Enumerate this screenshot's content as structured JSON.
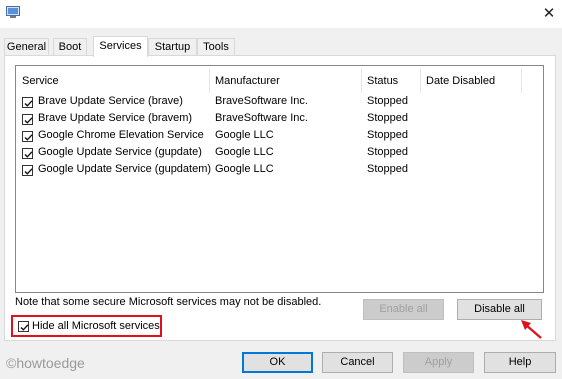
{
  "window": {
    "close_glyph": "✕"
  },
  "tabs": [
    {
      "label": "General"
    },
    {
      "label": "Boot"
    },
    {
      "label": "Services"
    },
    {
      "label": "Startup"
    },
    {
      "label": "Tools"
    }
  ],
  "services": {
    "columns": [
      "Service",
      "Manufacturer",
      "Status",
      "Date Disabled"
    ],
    "rows": [
      {
        "checked": true,
        "service": "Brave Update Service (brave)",
        "manufacturer": "BraveSoftware Inc.",
        "status": "Stopped",
        "date_disabled": ""
      },
      {
        "checked": true,
        "service": "Brave Update Service (bravem)",
        "manufacturer": "BraveSoftware Inc.",
        "status": "Stopped",
        "date_disabled": ""
      },
      {
        "checked": true,
        "service": "Google Chrome Elevation Service",
        "manufacturer": "Google LLC",
        "status": "Stopped",
        "date_disabled": ""
      },
      {
        "checked": true,
        "service": "Google Update Service (gupdate)",
        "manufacturer": "Google LLC",
        "status": "Stopped",
        "date_disabled": ""
      },
      {
        "checked": true,
        "service": "Google Update Service (gupdatem)",
        "manufacturer": "Google LLC",
        "status": "Stopped",
        "date_disabled": ""
      }
    ],
    "note": "Note that some secure Microsoft services may not be disabled.",
    "enable_all_label": "Enable all",
    "disable_all_label": "Disable all",
    "hide_ms_label": "Hide all Microsoft services",
    "hide_ms_checked": true
  },
  "footer": {
    "ok_label": "OK",
    "cancel_label": "Cancel",
    "apply_label": "Apply",
    "help_label": "Help"
  },
  "watermark": "©howtoedge",
  "colors": {
    "highlight": "#e0101c",
    "arrow": "#e0101c",
    "default_button_border": "#0078d7"
  }
}
